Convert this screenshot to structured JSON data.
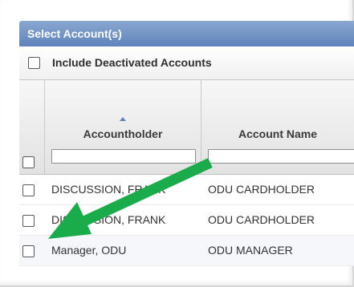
{
  "panel": {
    "title": "Select Account(s)",
    "include_deactivated_label": "Include Deactivated Accounts"
  },
  "table": {
    "columns": [
      {
        "label": "Accountholder",
        "sorted": "ascending"
      },
      {
        "label": "Account Name"
      }
    ],
    "filters": [
      "",
      ""
    ],
    "rows": [
      {
        "accountholder": "DISCUSSION, FRANK",
        "account_name": "ODU CARDHOLDER"
      },
      {
        "accountholder": "DISCUSSION, FRANK",
        "account_name": "ODU CARDHOLDER"
      },
      {
        "accountholder": "Manager, ODU",
        "account_name": "ODU MANAGER"
      }
    ]
  },
  "annotation": {
    "icon": "arrow-icon",
    "color": "#1aab4a"
  },
  "colors": {
    "header_bar": "#5f84bb",
    "sort_arrow": "#5f84bb"
  }
}
